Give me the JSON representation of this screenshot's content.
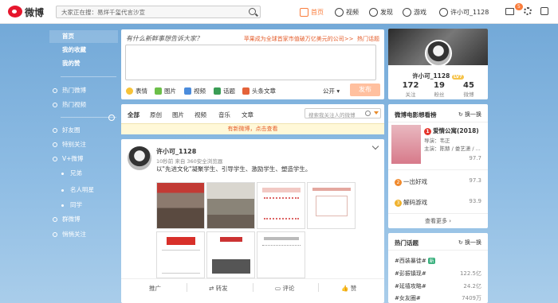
{
  "header": {
    "logo_text": "微博",
    "search_placeholder": "大家正在搜：易烊千玺代言沙宣",
    "nav": [
      {
        "label": "首页",
        "icon": "home-icon",
        "active": true
      },
      {
        "label": "视频",
        "icon": "video-icon"
      },
      {
        "label": "发现",
        "icon": "compass-icon"
      },
      {
        "label": "游戏",
        "icon": "gamepad-icon"
      },
      {
        "label": "许小可_1128",
        "icon": "user-icon"
      }
    ],
    "message_badge": "5"
  },
  "sidebar": {
    "items": [
      {
        "label": "首页"
      },
      {
        "label": "我的收藏"
      },
      {
        "label": "我的赞"
      },
      {
        "label": "热门微博"
      },
      {
        "label": "热门视频"
      },
      {
        "label": "好友圈"
      },
      {
        "label": "特别关注"
      },
      {
        "label": "V+微博"
      },
      {
        "label": "兄弟"
      },
      {
        "label": "名人明星"
      },
      {
        "label": "同学"
      },
      {
        "label": "群微博"
      },
      {
        "label": "悄悄关注"
      }
    ]
  },
  "composer": {
    "hint": "有什么新鲜事想告诉大家？",
    "ad": "苹果成为全球首家市值破万亿美元的公司>>",
    "hot_topic": "热门话题",
    "tools": [
      "表情",
      "图片",
      "视频",
      "话题",
      "头条文章"
    ],
    "scope": "公开",
    "publish": "发布"
  },
  "feed_tabs": {
    "tabs": [
      "全部",
      "原创",
      "图片",
      "视频",
      "音乐",
      "文章"
    ],
    "search_placeholder": "搜索我关注人的微博",
    "new_notice": "有新微博，点击查看"
  },
  "post": {
    "author": "许小可_1128",
    "meta": "10秒前 来自 360安全浏览器",
    "content": "以\"先进文化\"凝聚学生、引导学生、激励学生、塑造学生。",
    "actions": [
      "推广",
      "转发",
      "评论",
      "赞"
    ]
  },
  "profile": {
    "name": "许小可_1128",
    "level": "LV7",
    "stats": [
      {
        "value": "172",
        "label": "关注"
      },
      {
        "value": "19",
        "label": "粉丝"
      },
      {
        "value": "45",
        "label": "微博"
      }
    ]
  },
  "movie_card": {
    "title": "微博电影想看榜",
    "refresh": "换一换",
    "top": {
      "rank": "1",
      "name": "爱情公寓(2018)",
      "director": "导演：韦正",
      "cast": "主演：陈赫 / 娄艺潇 / ...",
      "score": "97.7"
    },
    "others": [
      {
        "rank": "2",
        "name": "一出好戏",
        "score": "97.3"
      },
      {
        "rank": "3",
        "name": "解码游戏",
        "score": "93.9"
      }
    ],
    "more": "查看更多 ›"
  },
  "topics_card": {
    "title": "热门话题",
    "refresh": "换一换",
    "items": [
      {
        "name": "#西装暴徒#",
        "tag": "新",
        "value": ""
      },
      {
        "name": "#彭振镇现#",
        "value": "122.5亿"
      },
      {
        "name": "#延禧攻略#",
        "value": "24.2亿"
      },
      {
        "name": "#女友圈#",
        "value": "7409万"
      }
    ]
  },
  "colors": {
    "accent": "#fa7d3c",
    "link": "#e45d2b",
    "brand": "#e6162d"
  }
}
